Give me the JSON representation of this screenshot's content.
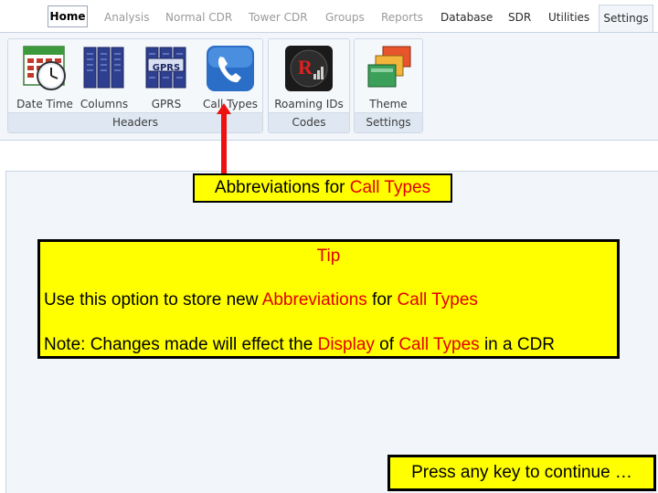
{
  "tabs": {
    "home": "Home",
    "items": [
      "Analysis",
      "Normal CDR",
      "Tower CDR",
      "Groups",
      "Reports",
      "Database",
      "SDR",
      "Utilities"
    ],
    "active": "Settings"
  },
  "ribbon": {
    "groups": {
      "headers": {
        "label": "Headers",
        "buttons": [
          "Date Time",
          "Columns",
          "GPRS",
          "Call Types"
        ],
        "gprs_badge": "GPRS"
      },
      "codes": {
        "label": "Codes",
        "buttons": [
          "Roaming IDs"
        ],
        "roaming_badge": "R"
      },
      "settings": {
        "label": "Settings",
        "buttons": [
          "Theme"
        ]
      }
    }
  },
  "callout": {
    "prefix": "Abbreviations for ",
    "highlight": "Call Types"
  },
  "tip": {
    "title": "Tip",
    "line1_a": "Use this option to store new ",
    "line1_b": "Abbreviations",
    "line1_c": " for ",
    "line1_d": "Call Types",
    "line2_a": "Note: Changes made will effect the ",
    "line2_b": "Display",
    "line2_c": " of ",
    "line2_d": "Call Types",
    "line2_e": " in a CDR"
  },
  "continue_text": "Press any key to continue …",
  "colors": {
    "highlight_bg": "#ffff00",
    "emphasis_red": "#e00000",
    "ribbon_bg": "#f2f5f9",
    "dark_tab_text": "#2a2a2a"
  }
}
